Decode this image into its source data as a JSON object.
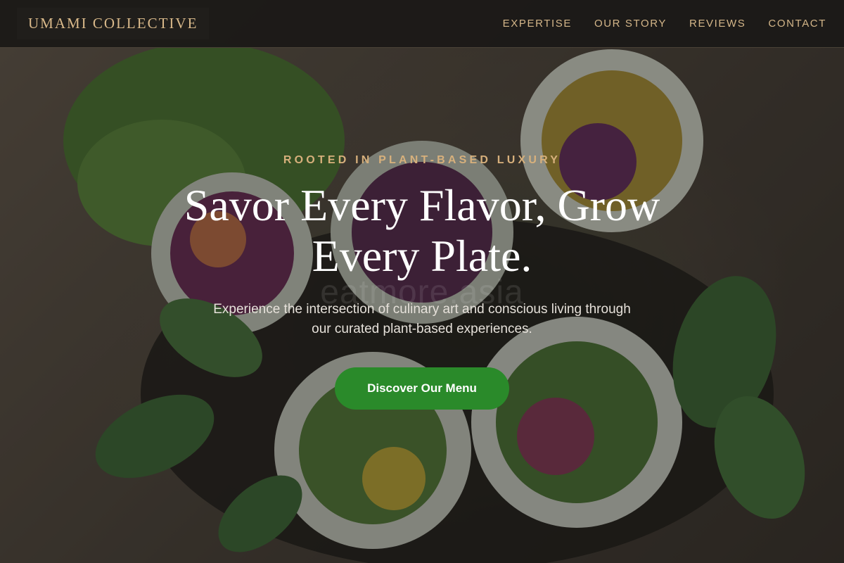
{
  "brand": {
    "name": "UMAMI COLLECTIVE"
  },
  "nav": {
    "items": [
      {
        "label": "EXPERTISE"
      },
      {
        "label": "OUR STORY"
      },
      {
        "label": "REVIEWS"
      },
      {
        "label": "CONTACT"
      }
    ]
  },
  "hero": {
    "eyebrow": "ROOTED IN PLANT-BASED LUXURY",
    "headline_line1": "Savor Every Flavor, Grow",
    "headline_line2": "Every Plate.",
    "subtitle_line1": "Experience the intersection of culinary art and conscious living through",
    "subtitle_line2": "our curated plant-based experiences.",
    "cta_label": "Discover Our Menu",
    "watermark": "eatmore.asia",
    "image_subject": "fresh-spring-rolls-photo"
  },
  "colors": {
    "accent_gold": "#d4b689",
    "cta_green": "#2a8a2a",
    "nav_bg": "#1c1a18"
  }
}
